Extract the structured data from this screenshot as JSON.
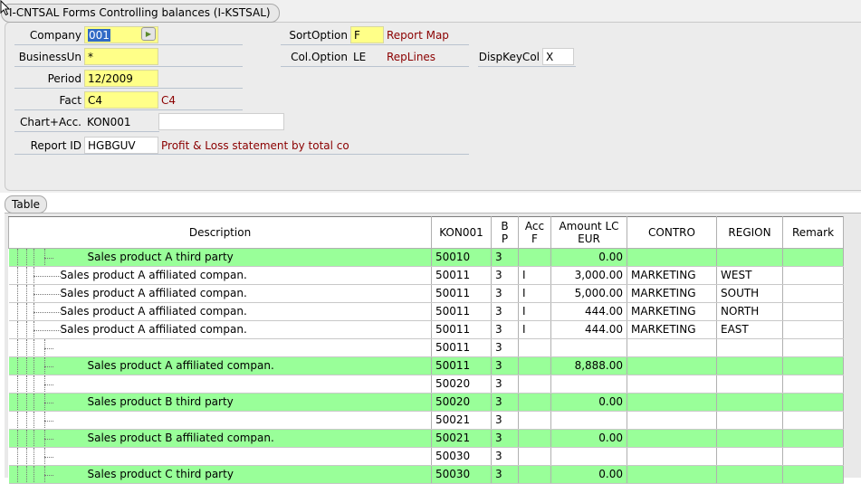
{
  "window": {
    "title": "I-CNTSAL Forms Controlling balances (I-KSTSAL)"
  },
  "form": {
    "company": {
      "label": "Company",
      "value": "001"
    },
    "business_unit": {
      "label": "BusinessUn",
      "value": "*"
    },
    "period": {
      "label": "Period",
      "value": "12/2009"
    },
    "fact": {
      "label": "Fact",
      "value": "C4",
      "desc": "C4"
    },
    "chart_acc": {
      "label": "Chart+Acc.",
      "value": "KON001",
      "value2": ""
    },
    "report_id": {
      "label": "Report ID",
      "value": "HGBGUV",
      "desc": "Profit & Loss statement by total co"
    },
    "sort_option": {
      "label": "SortOption",
      "value": "F",
      "desc": "Report Map"
    },
    "col_option": {
      "label": "Col.Option",
      "value": "LE",
      "desc": "RepLines"
    },
    "disp_key_col": {
      "label": "DispKeyCol",
      "value": "X"
    }
  },
  "table": {
    "tab_label": "Table",
    "headers": {
      "description": "Description",
      "kon001": "KON001",
      "bp_1": "B",
      "bp_2": "P",
      "accf_1": "Acc",
      "accf_2": "F",
      "amount_1": "Amount LC",
      "amount_2": "EUR",
      "contro": "CONTRO",
      "region": "REGION",
      "remark": "Remark"
    },
    "rows": [
      {
        "level": 1,
        "description": "Sales product A third party",
        "kon": "50010",
        "bp": "3",
        "acc": "",
        "amount": "0.00",
        "contro": "",
        "region": "",
        "remark": "",
        "green": true
      },
      {
        "level": 0,
        "description": "Sales product A affiliated compan.",
        "kon": "50011",
        "bp": "3",
        "acc": "I",
        "amount": "3,000.00",
        "contro": "MARKETING",
        "region": "WEST",
        "remark": "",
        "green": false
      },
      {
        "level": 0,
        "description": "Sales product A affiliated compan.",
        "kon": "50011",
        "bp": "3",
        "acc": "I",
        "amount": "5,000.00",
        "contro": "MARKETING",
        "region": "SOUTH",
        "remark": "",
        "green": false
      },
      {
        "level": 0,
        "description": "Sales product A affiliated compan.",
        "kon": "50011",
        "bp": "3",
        "acc": "I",
        "amount": "444.00",
        "contro": "MARKETING",
        "region": "NORTH",
        "remark": "",
        "green": false
      },
      {
        "level": 0,
        "description": "Sales product A affiliated compan.",
        "kon": "50011",
        "bp": "3",
        "acc": "I",
        "amount": "444.00",
        "contro": "MARKETING",
        "region": "EAST",
        "remark": "",
        "green": false
      },
      {
        "level": 1,
        "description": "",
        "kon": "50011",
        "bp": "3",
        "acc": "",
        "amount": "",
        "contro": "",
        "region": "",
        "remark": "",
        "green": false
      },
      {
        "level": 1,
        "description": "Sales product A affiliated compan.",
        "kon": "50011",
        "bp": "3",
        "acc": "",
        "amount": "8,888.00",
        "contro": "",
        "region": "",
        "remark": "",
        "green": true
      },
      {
        "level": 1,
        "description": "",
        "kon": "50020",
        "bp": "3",
        "acc": "",
        "amount": "",
        "contro": "",
        "region": "",
        "remark": "",
        "green": false
      },
      {
        "level": 1,
        "description": "Sales product B third party",
        "kon": "50020",
        "bp": "3",
        "acc": "",
        "amount": "0.00",
        "contro": "",
        "region": "",
        "remark": "",
        "green": true
      },
      {
        "level": 1,
        "description": "",
        "kon": "50021",
        "bp": "3",
        "acc": "",
        "amount": "",
        "contro": "",
        "region": "",
        "remark": "",
        "green": false
      },
      {
        "level": 1,
        "description": "Sales product B affiliated compan.",
        "kon": "50021",
        "bp": "3",
        "acc": "",
        "amount": "0.00",
        "contro": "",
        "region": "",
        "remark": "",
        "green": true
      },
      {
        "level": 1,
        "description": "",
        "kon": "50030",
        "bp": "3",
        "acc": "",
        "amount": "",
        "contro": "",
        "region": "",
        "remark": "",
        "green": false
      },
      {
        "level": 1,
        "description": "Sales product C third party",
        "kon": "50030",
        "bp": "3",
        "acc": "",
        "amount": "0.00",
        "contro": "",
        "region": "",
        "remark": "",
        "green": true
      }
    ]
  }
}
